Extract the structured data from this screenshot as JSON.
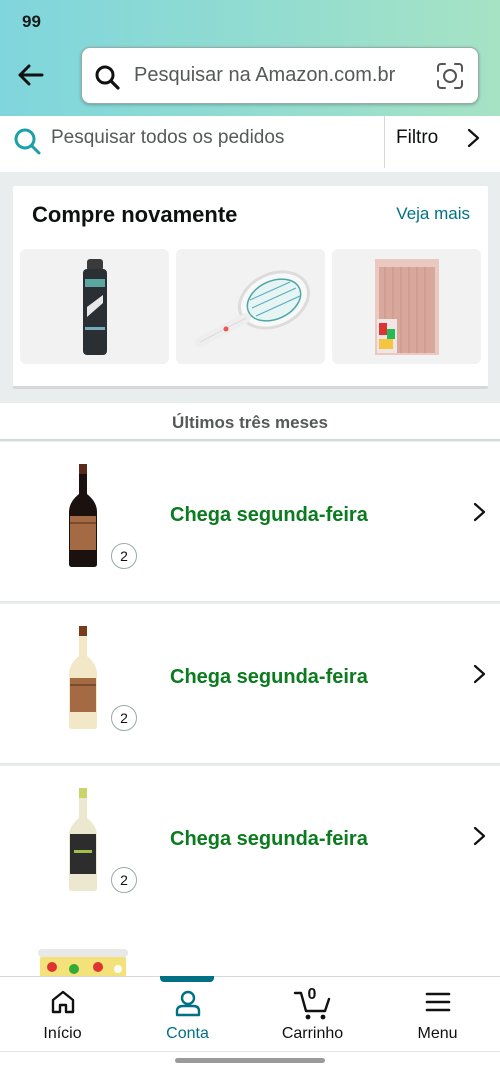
{
  "status_bar": {
    "indicator": "99"
  },
  "header": {
    "search_placeholder": "Pesquisar na Amazon.com.br",
    "back_icon": "back-arrow-icon",
    "camera_icon": "camera-scan-icon"
  },
  "orders_search": {
    "placeholder": "Pesquisar todos os pedidos",
    "filter_label": "Filtro"
  },
  "buy_again": {
    "title": "Compre novamente",
    "see_more": "Veja mais",
    "items": [
      {
        "icon": "deodorant-product-thumbnail"
      },
      {
        "icon": "electric-racket-product-thumbnail"
      },
      {
        "icon": "shower-curtain-product-thumbnail"
      }
    ]
  },
  "section_label": "Últimos três meses",
  "orders": [
    {
      "status": "Chega segunda-feira",
      "quantity": "2",
      "product": "red-wine-bottle"
    },
    {
      "status": "Chega segunda-feira",
      "quantity": "2",
      "product": "white-wine-bottle"
    },
    {
      "status": "Chega segunda-feira",
      "quantity": "2",
      "product": "white-wine-bottle-green"
    }
  ],
  "bottom_nav": {
    "items": [
      {
        "label": "Início",
        "icon": "home-icon"
      },
      {
        "label": "Conta",
        "icon": "account-icon",
        "active": true
      },
      {
        "label": "Carrinho",
        "icon": "cart-icon",
        "badge": "0"
      },
      {
        "label": "Menu",
        "icon": "menu-icon"
      }
    ]
  },
  "colors": {
    "accent_teal": "#007185",
    "delivery_green": "#0a7b1e",
    "header_gradient_start": "#7fd6dc",
    "header_gradient_end": "#a6e3c4"
  }
}
